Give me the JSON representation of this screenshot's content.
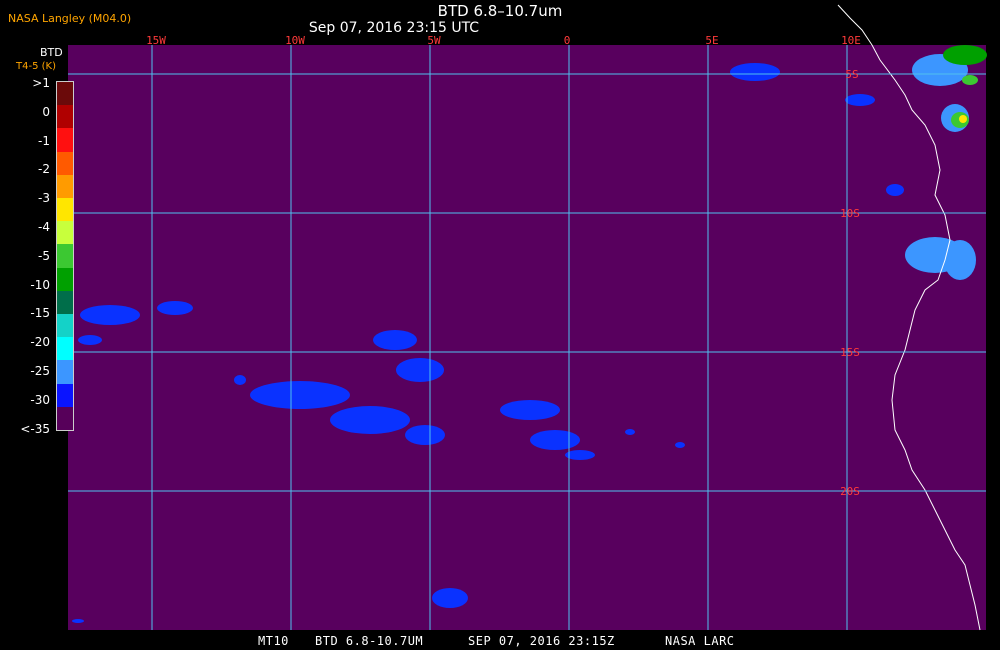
{
  "header": {
    "credit": "NASA Langley (M04.0)",
    "title": "BTD 6.8–10.7um",
    "datetime": "Sep 07, 2016 23:15 UTC"
  },
  "legend": {
    "title": "BTD",
    "unit": "T4-5 (K)",
    "labels": [
      ">1",
      "0",
      "-1",
      "-2",
      "-3",
      "-4",
      "-5",
      "-10",
      "-15",
      "-20",
      "-25",
      "-30",
      "<-35"
    ],
    "colors": [
      "#6b0a0a",
      "#b00000",
      "#ff1010",
      "#ff5a00",
      "#ff9b00",
      "#ffe600",
      "#c8ff3c",
      "#3cc832",
      "#00a000",
      "#006e4a",
      "#14d2c8",
      "#00ffff",
      "#3c96ff",
      "#0a14ff",
      "#57005a"
    ]
  },
  "map": {
    "lon_labels": [
      "15W",
      "10W",
      "5W",
      "0",
      "5E",
      "10E"
    ],
    "lat_labels": [
      "5S",
      "10S",
      "15S",
      "20S"
    ],
    "colors": {
      "background": "#58005e",
      "grid": "#4fc0ef",
      "lon_label": "#ff3a3a",
      "lat_label": "#ff3a3a",
      "coast": "#ffffff",
      "cloud_blue": "#0a32ff",
      "cloud_light": "#3c96ff"
    }
  },
  "footer": {
    "satellite": "MT10",
    "product": "BTD 6.8-10.7UM",
    "date": "SEP 07, 2016 23:15Z",
    "source": "NASA LARC"
  }
}
